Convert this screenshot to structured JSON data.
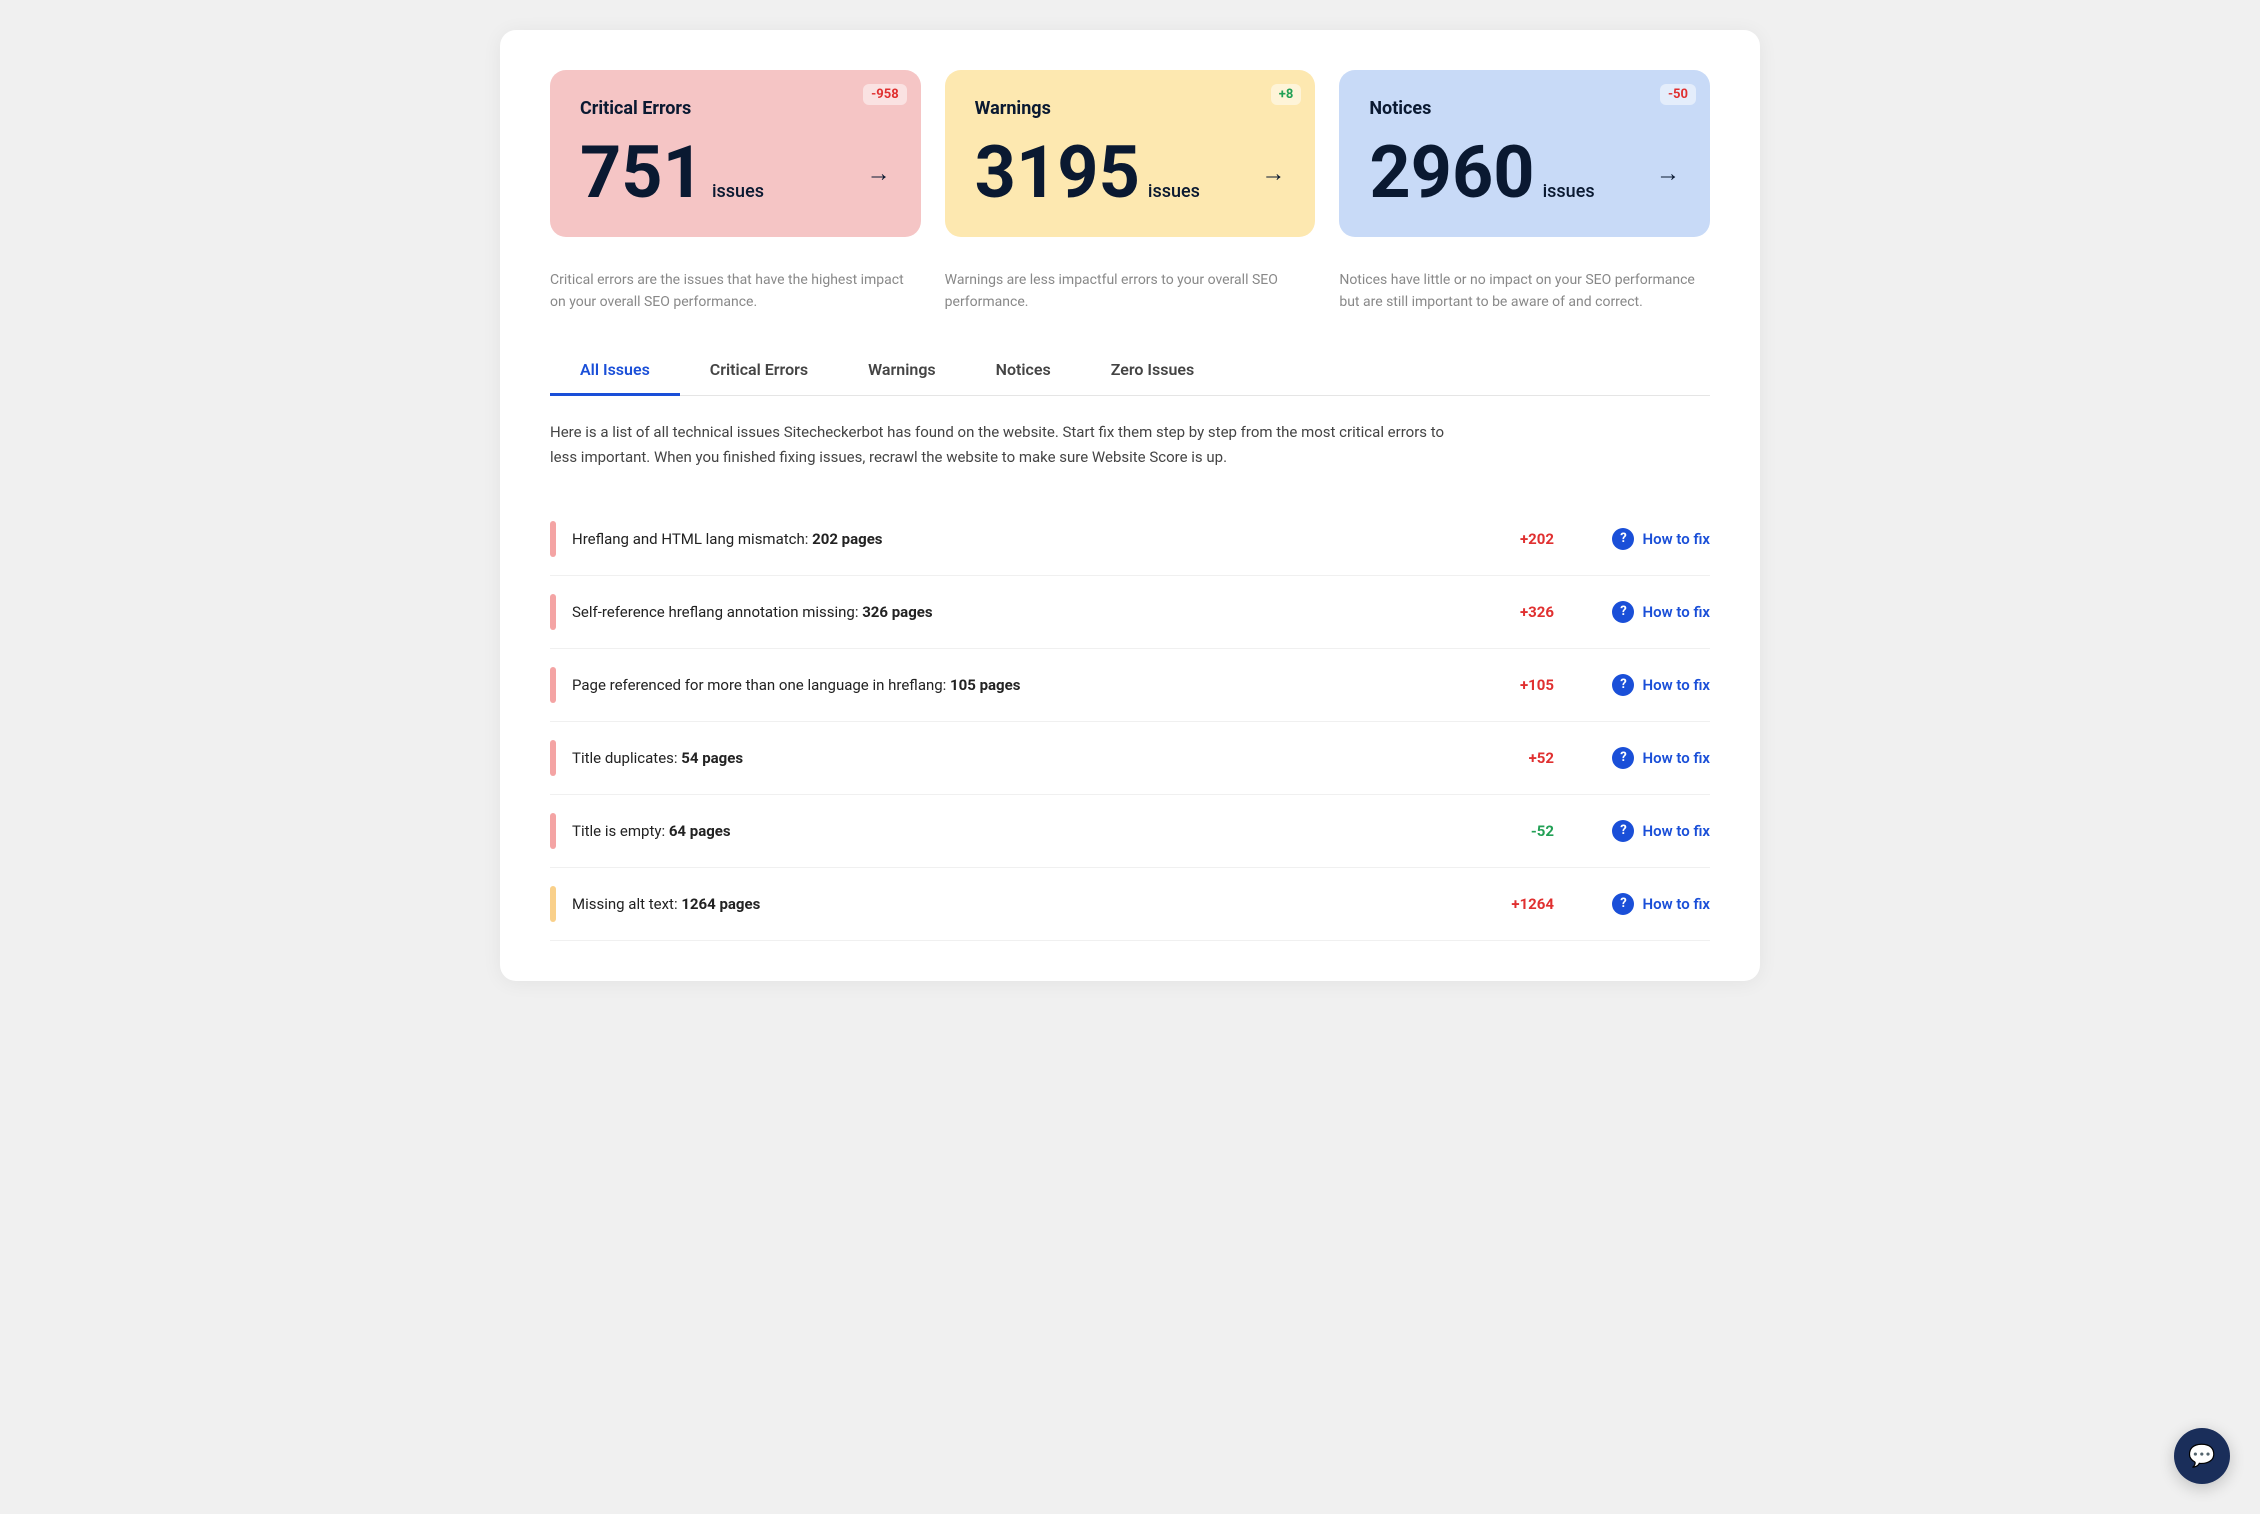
{
  "summary": {
    "cards": [
      {
        "id": "critical",
        "title": "Critical Errors",
        "count": "751",
        "count_label": "issues",
        "badge": "-958",
        "badge_type": "red",
        "type": "critical",
        "description": "Critical errors are the issues that have the highest impact on your overall SEO performance."
      },
      {
        "id": "warnings",
        "title": "Warnings",
        "count": "3195",
        "count_label": "issues",
        "badge": "+8",
        "badge_type": "green",
        "type": "warnings",
        "description": "Warnings are less impactful errors to your overall SEO performance."
      },
      {
        "id": "notices",
        "title": "Notices",
        "count": "2960",
        "count_label": "issues",
        "badge": "-50",
        "badge_type": "red",
        "type": "notices",
        "description": "Notices have little or no impact on your SEO performance but are still important to be aware of and correct."
      }
    ]
  },
  "tabs": [
    {
      "id": "all",
      "label": "All Issues",
      "active": true
    },
    {
      "id": "critical",
      "label": "Critical Errors",
      "active": false
    },
    {
      "id": "warnings",
      "label": "Warnings",
      "active": false
    },
    {
      "id": "notices",
      "label": "Notices",
      "active": false
    },
    {
      "id": "zero",
      "label": "Zero Issues",
      "active": false
    }
  ],
  "issues_description": "Here is a list of all technical issues Sitecheckerbot has found on the website. Start fix them step by step from the most critical errors to less important. When you finished fixing issues, recrawl the website to make sure Website Score is up.",
  "issues": [
    {
      "id": 1,
      "text_before": "Hreflang and HTML lang mismatch: ",
      "text_bold": "202 pages",
      "count": "+202",
      "count_type": "positive",
      "indicator": "red",
      "how_to_fix": "How to fix"
    },
    {
      "id": 2,
      "text_before": "Self-reference hreflang annotation missing: ",
      "text_bold": "326 pages",
      "count": "+326",
      "count_type": "positive",
      "indicator": "red",
      "how_to_fix": "How to fix"
    },
    {
      "id": 3,
      "text_before": "Page referenced for more than one language in hreflang: ",
      "text_bold": "105 pages",
      "count": "+105",
      "count_type": "positive",
      "indicator": "red",
      "how_to_fix": "How to fix"
    },
    {
      "id": 4,
      "text_before": "Title duplicates: ",
      "text_bold": "54 pages",
      "count": "+52",
      "count_type": "positive",
      "indicator": "red",
      "how_to_fix": "How to fix"
    },
    {
      "id": 5,
      "text_before": "Title is empty: ",
      "text_bold": "64 pages",
      "count": "-52",
      "count_type": "negative",
      "indicator": "red",
      "how_to_fix": "How to fix"
    },
    {
      "id": 6,
      "text_before": "Missing alt text: ",
      "text_bold": "1264 pages",
      "count": "+1264",
      "count_type": "positive",
      "indicator": "orange",
      "how_to_fix": "How to fix"
    }
  ],
  "help_icon_label": "?",
  "chat_icon": "💬"
}
